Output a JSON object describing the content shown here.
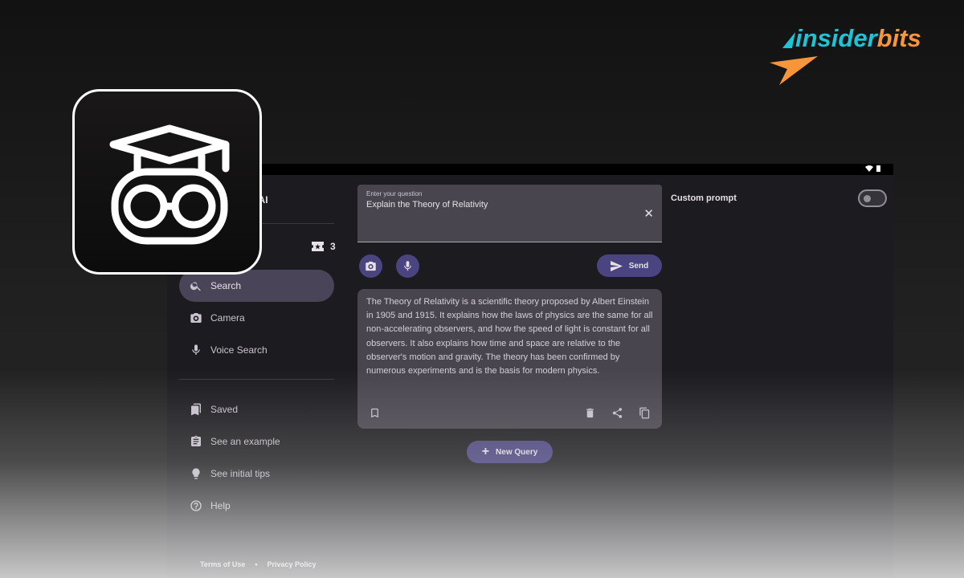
{
  "brand": {
    "logo_part1": "insider",
    "logo_part2": "bits",
    "color1": "#1fc3d6",
    "color2": "#f7953a"
  },
  "app": {
    "title": "Homework Help AI",
    "visible_title": "lp AI",
    "credits": "3",
    "nav": [
      {
        "label": "Search",
        "icon": "search-icon",
        "active": true
      },
      {
        "label": "Camera",
        "icon": "camera-icon"
      },
      {
        "label": "Voice Search",
        "icon": "mic-icon"
      },
      {
        "label": "Saved",
        "icon": "bookmarks-icon"
      },
      {
        "label": "See an example",
        "icon": "clipboard-icon"
      },
      {
        "label": "See initial tips",
        "icon": "lightbulb-icon"
      },
      {
        "label": "Help",
        "icon": "help-icon"
      }
    ],
    "footer": {
      "terms": "Terms of Use",
      "sep": "•",
      "privacy": "Privacy Policy"
    },
    "question": {
      "label": "Enter your question",
      "value": "Explain the Theory of Relativity"
    },
    "send_label": "Send",
    "answer": "The Theory of Relativity is a scientific theory proposed by Albert Einstein in 1905 and 1915. It explains how the laws of physics are the same for all non-accelerating observers, and how the speed of light is constant for all observers. It also explains how time and space are relative to the observer's motion and gravity. The theory has been confirmed by numerous experiments and is the basis for modern physics.",
    "new_query_label": "New Query",
    "custom_prompt_label": "Custom prompt",
    "custom_prompt_enabled": false,
    "accent": "#4a4480"
  }
}
